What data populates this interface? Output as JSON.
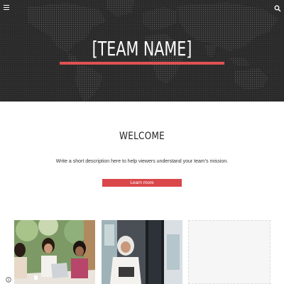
{
  "header": {
    "menu_icon": "hamburger-menu-icon",
    "search_icon": "search-icon",
    "title": "[TEAM NAME]",
    "accent_color": "#e05152",
    "background": "world-map-dotted"
  },
  "welcome": {
    "heading": "WELCOME",
    "description": "Write a short description here to help viewers understand your team's mission.",
    "button_label": "Learn more",
    "button_color": "#d9474a"
  },
  "gallery": {
    "images": [
      {
        "name": "team-meeting-photo"
      },
      {
        "name": "woman-with-tablet-photo"
      },
      {
        "name": "empty-image-placeholder"
      }
    ]
  },
  "footer": {
    "info_icon": "info-icon"
  }
}
